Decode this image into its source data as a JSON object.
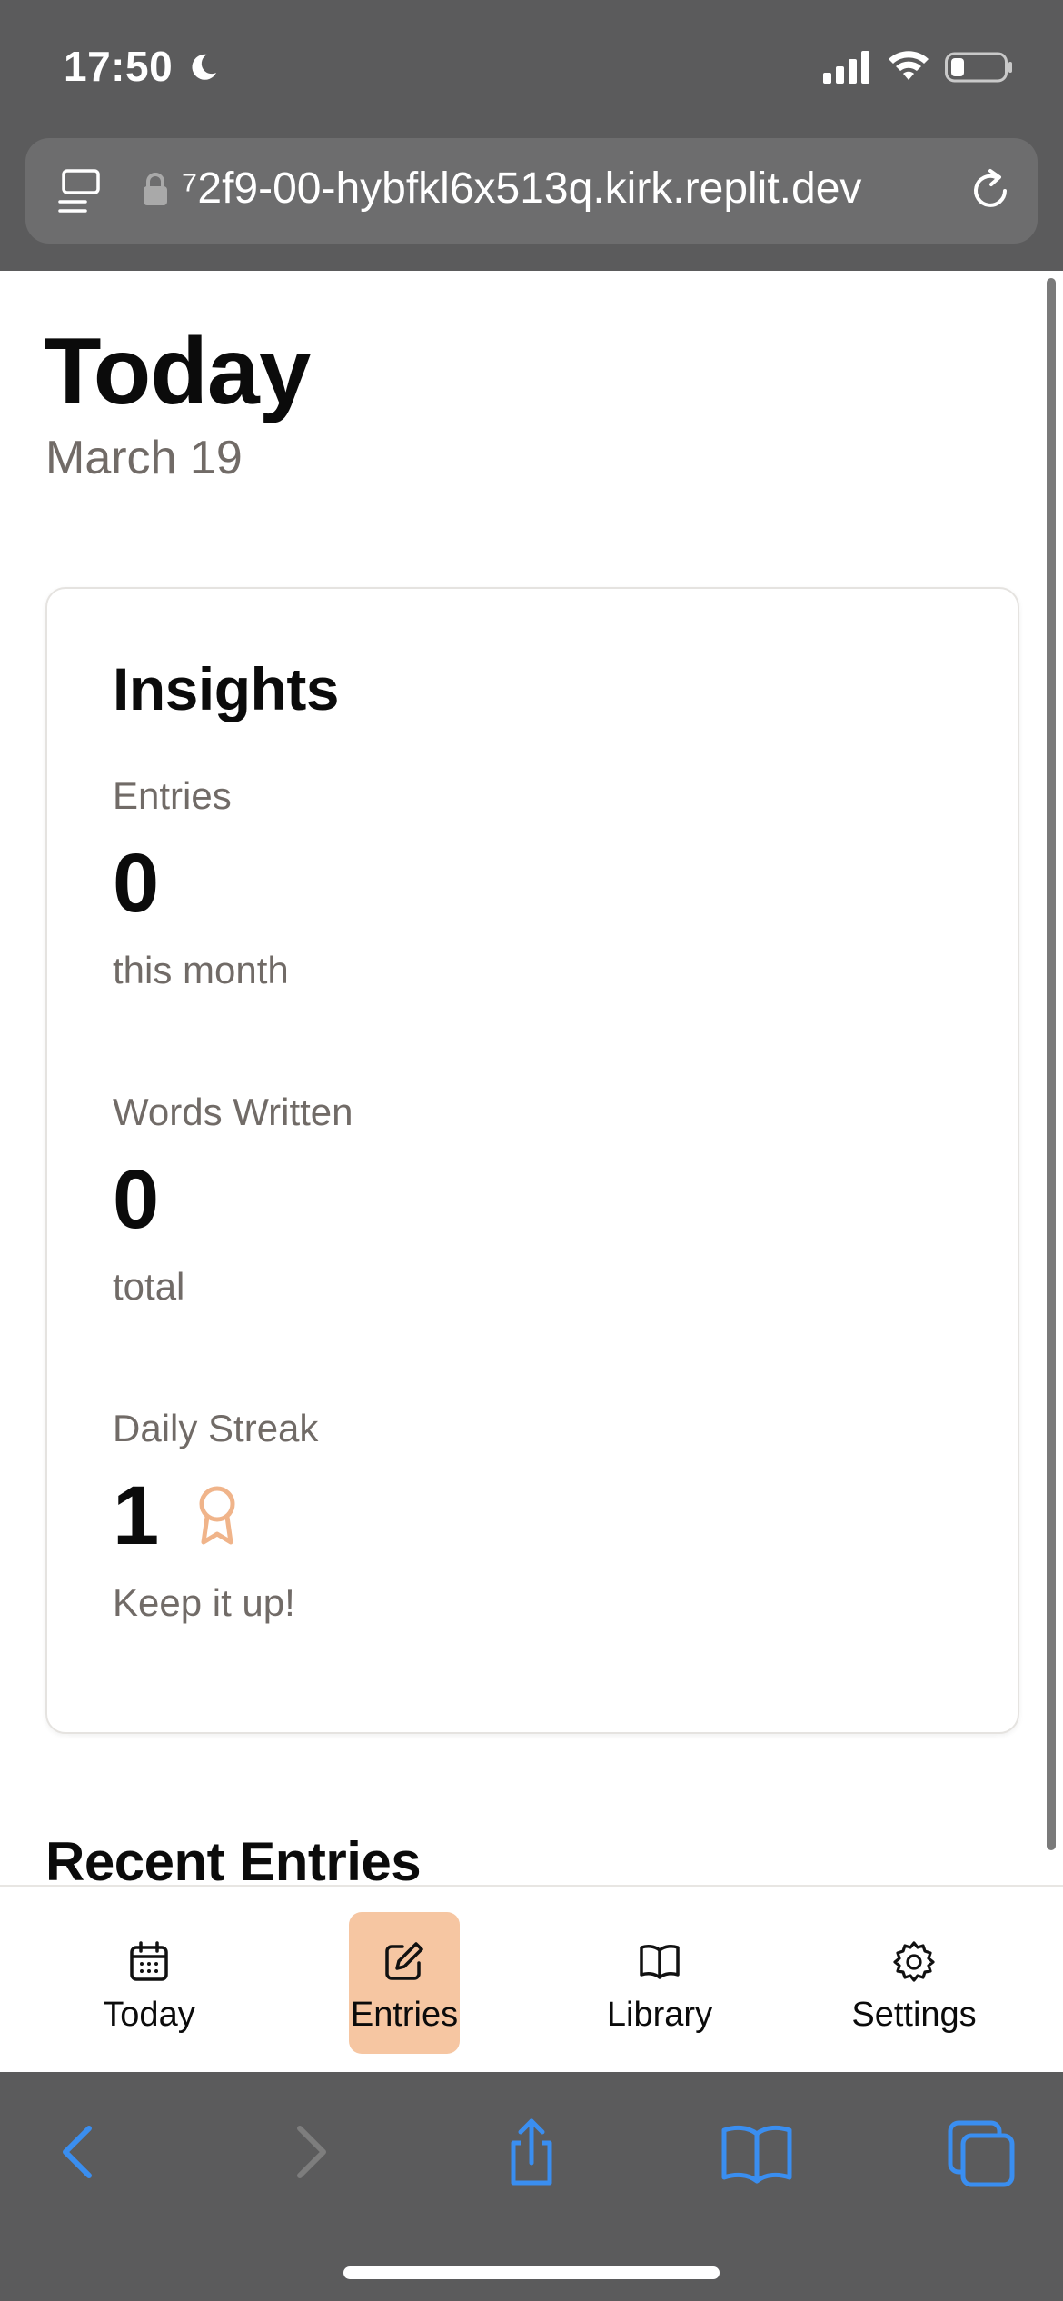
{
  "status_bar": {
    "time": "17:50"
  },
  "browser": {
    "url": "⁷2f9-00-hybfkl6x513q.kirk.replit.dev"
  },
  "page": {
    "title": "Today",
    "date": "March 19",
    "insights": {
      "title": "Insights",
      "stats": [
        {
          "label": "Entries",
          "value": "0",
          "caption": "this month"
        },
        {
          "label": "Words Written",
          "value": "0",
          "caption": "total"
        },
        {
          "label": "Daily Streak",
          "value": "1",
          "caption": "Keep it up!",
          "icon": "award-icon"
        }
      ]
    },
    "recent_entries_title": "Recent Entries"
  },
  "nav": {
    "items": [
      {
        "label": "Today",
        "icon": "calendar-icon"
      },
      {
        "label": "Entries",
        "icon": "pencil-square-icon",
        "active": true
      },
      {
        "label": "Library",
        "icon": "book-open-icon"
      },
      {
        "label": "Settings",
        "icon": "gear-icon"
      }
    ]
  },
  "colors": {
    "accent": "#f6c6a2",
    "accent_icon": "#f0b48a",
    "browser_chrome": "#5b5b5c",
    "safari_blue": "#3a8ef0",
    "muted_text": "#716b67"
  }
}
